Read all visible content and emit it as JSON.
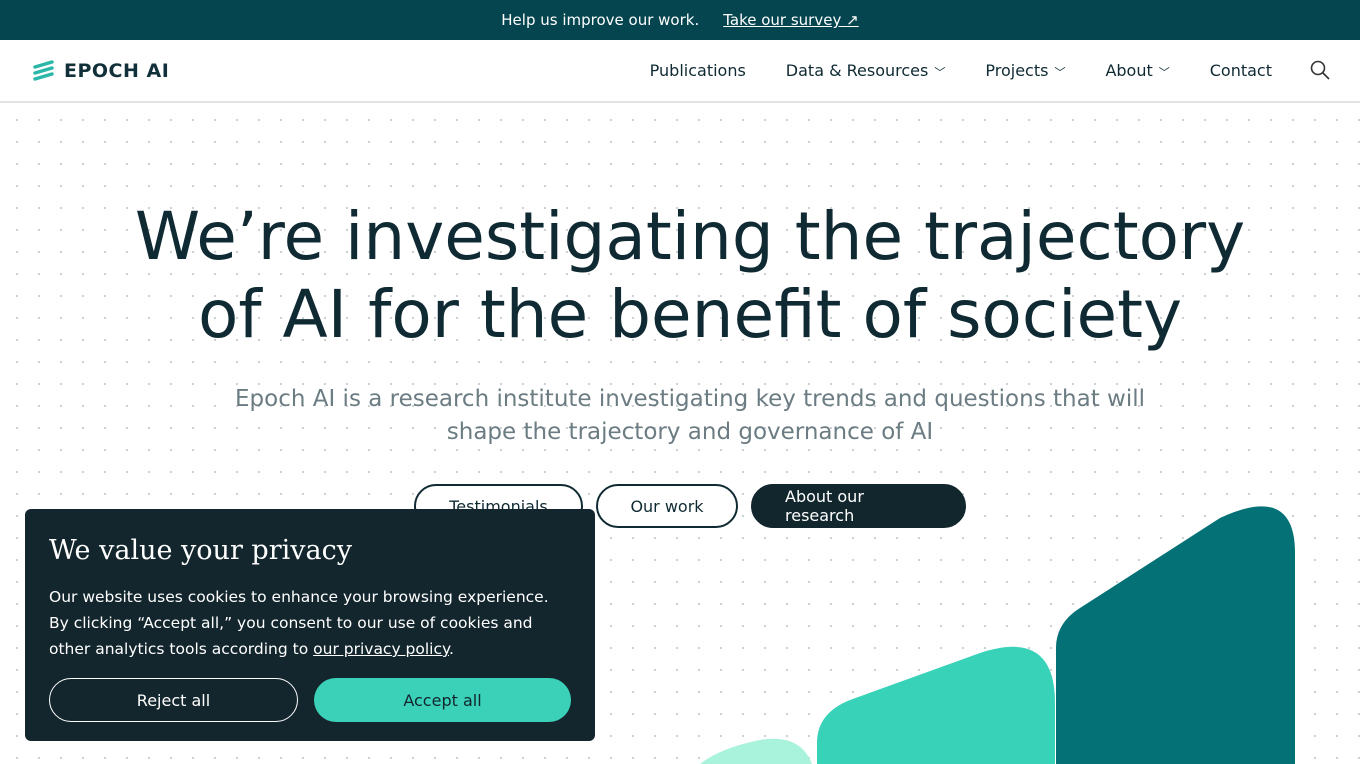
{
  "banner": {
    "text": "Help us improve our work.",
    "link": "Take our survey",
    "link_icon": "arrow-up-right-icon"
  },
  "nav": {
    "logo": "EPOCH AI",
    "items": [
      {
        "label": "Publications",
        "dropdown": false
      },
      {
        "label": "Data & Resources",
        "dropdown": true
      },
      {
        "label": "Projects",
        "dropdown": true
      },
      {
        "label": "About",
        "dropdown": true
      },
      {
        "label": "Contact",
        "dropdown": false
      }
    ],
    "search_icon": "search-icon"
  },
  "hero": {
    "title_line1": "We’re investigating the trajectory",
    "title_line2": "of AI for the benefit of society",
    "subtitle": "Epoch AI is a research institute investigating key trends and questions that will shape the trajectory and governance of AI",
    "buttons": [
      "Testimonials",
      "Our work",
      "About our research"
    ]
  },
  "cookie": {
    "title": "We value your privacy",
    "text": "Our website uses cookies to enhance your browsing experience. By clicking “Accept all,” you consent to our use of cookies and other analytics tools according to ",
    "link": "our privacy policy",
    "end": ".",
    "reject": "Reject all",
    "accept": "Accept all"
  },
  "colors": {
    "banner": "#05454f",
    "dark": "#12262d",
    "accent": "#3ad1b8",
    "teal_dark": "#047176",
    "mint": "#a9f2dc"
  }
}
